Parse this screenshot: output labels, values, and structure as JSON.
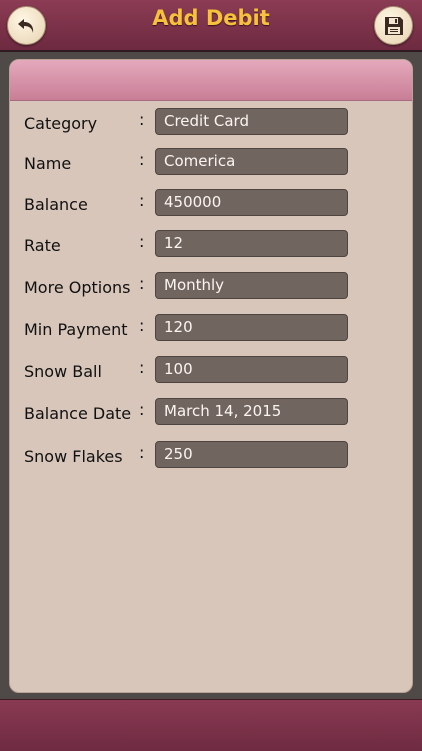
{
  "header": {
    "title": "Add Debit",
    "back_icon": "undo-arrow-icon",
    "save_icon": "floppy-disk-icon"
  },
  "form": {
    "rows": [
      {
        "label": "Category",
        "value": "Credit Card"
      },
      {
        "label": "Name",
        "value": "Comerica"
      },
      {
        "label": "Balance",
        "value": "450000"
      },
      {
        "label": "Rate",
        "value": "12"
      },
      {
        "label": "More Options",
        "value": "Monthly"
      },
      {
        "label": "Min Payment",
        "value": "120"
      },
      {
        "label": "Snow Ball",
        "value": "100"
      },
      {
        "label": "Balance Date",
        "value": "March 14, 2015"
      },
      {
        "label": "Snow Flakes",
        "value": "250"
      }
    ],
    "separator": ":"
  },
  "colors": {
    "bar": "#7a3149",
    "title": "#f6c23b",
    "card": "#d8c6bb",
    "field": "#716560"
  }
}
